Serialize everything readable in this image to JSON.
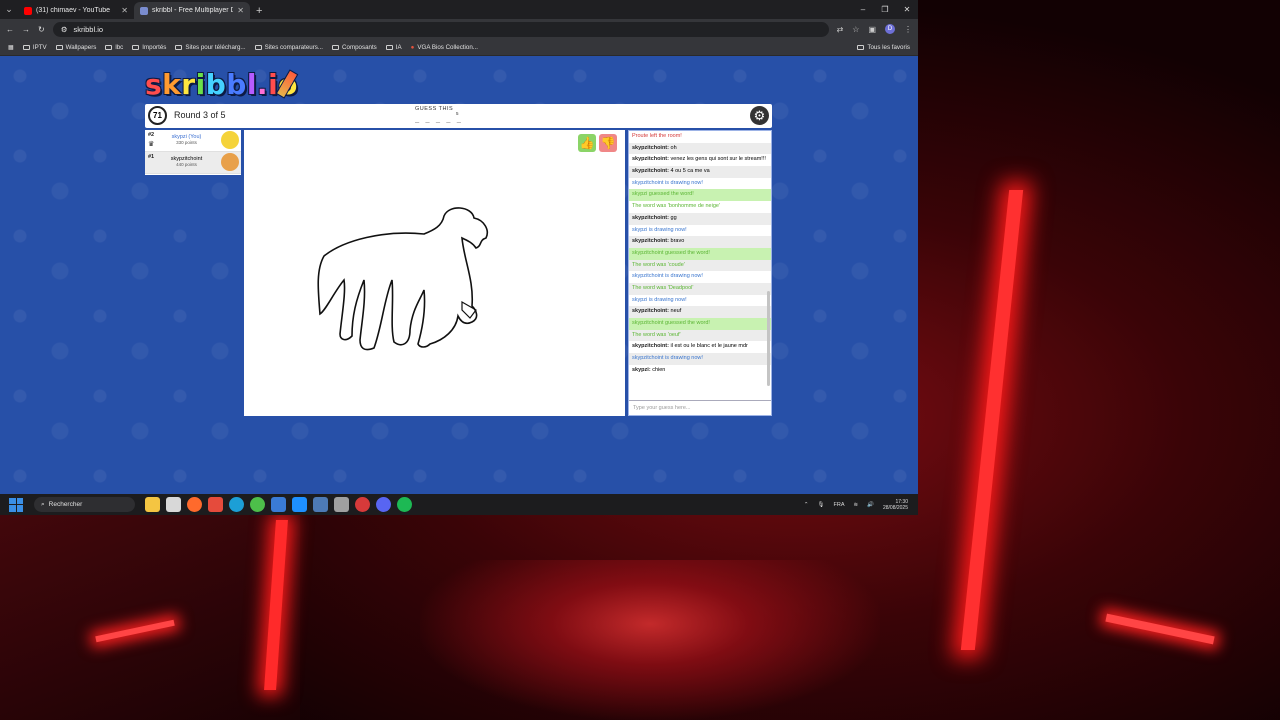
{
  "browser": {
    "tabs": [
      {
        "title": "(31) chimaev - YouTube",
        "favicon_color": "#ff0000",
        "active": false
      },
      {
        "title": "skribbl - Free Multiplayer Draw…",
        "favicon_color": "#7a8ccf",
        "active": true
      }
    ],
    "new_tab_symbol": "+",
    "window_controls": [
      "–",
      "❐",
      "✕"
    ],
    "address": "skribbl.io",
    "bookmarks": [
      "IPTV",
      "Wallpapers",
      "lbc",
      "Importés",
      "Sites pour télécharg...",
      "Sites comparateurs...",
      "Composants",
      "IA",
      "VGA Bios Collection..."
    ],
    "bookmarks_right": "Tous les favoris",
    "profile_letter": "D"
  },
  "game": {
    "logo_letters": [
      "s",
      "k",
      "r",
      "i",
      "b",
      "b",
      "l",
      ".",
      "i",
      "o"
    ],
    "timer": "71",
    "round": "Round 3 of 5",
    "guess_label": "GUESS THIS",
    "word_hint": "_ _ _ _ _",
    "word_length": "5",
    "players": [
      {
        "rank": "#2",
        "name": "skypzi (You)",
        "points": "330 points",
        "name_color": "#3a6fd1",
        "avatar_color": "#f5d33a",
        "crown": "♛"
      },
      {
        "rank": "#1",
        "name": "skypzitchoint",
        "points": "440 points",
        "name_color": "#222222",
        "avatar_color": "#e8a04a",
        "crown": ""
      }
    ],
    "thumb_up": "👍",
    "thumb_down": "👎",
    "chat": [
      {
        "type": "sys-red",
        "text": "Proute left the room!"
      },
      {
        "type": "msg",
        "user": "skypzitchoint:",
        "text": "oh"
      },
      {
        "type": "msg",
        "user": "skypzitchoint:",
        "text": "venez les gens qui sont sur le stream!!!"
      },
      {
        "type": "msg",
        "user": "skypzitchoint:",
        "text": "4 ou 5 ca me va"
      },
      {
        "type": "sys-blue",
        "text": "skypzitchoint is drawing now!"
      },
      {
        "type": "sys-green",
        "text": "skypzi guessed the word!"
      },
      {
        "type": "word-green",
        "text": "The word was 'bonhomme de neige'"
      },
      {
        "type": "msg",
        "user": "skypzitchoint:",
        "text": "gg"
      },
      {
        "type": "sys-blue",
        "text": "skypzi is drawing now!"
      },
      {
        "type": "msg",
        "user": "skypzitchoint:",
        "text": "bravo"
      },
      {
        "type": "sys-green",
        "text": "skypzitchoint guessed the word!"
      },
      {
        "type": "word-green",
        "text": "The word was 'coude'"
      },
      {
        "type": "sys-blue",
        "text": "skypzitchoint is drawing now!"
      },
      {
        "type": "word-green",
        "text": "The word was 'Deadpool'"
      },
      {
        "type": "sys-blue",
        "text": "skypzi is drawing now!"
      },
      {
        "type": "msg",
        "user": "skypzitchoint:",
        "text": "neuf"
      },
      {
        "type": "sys-green",
        "text": "skypzitchoint guessed the word!"
      },
      {
        "type": "word-green",
        "text": "The word was 'oeuf'"
      },
      {
        "type": "msg",
        "user": "skypzitchoint:",
        "text": "il est ou le blanc et le jaune mdr"
      },
      {
        "type": "sys-blue",
        "text": "skypzitchoint is drawing now!"
      },
      {
        "type": "msg",
        "user": "skypzi:",
        "text": "chien"
      }
    ],
    "chat_placeholder": "Type your guess here..."
  },
  "taskbar": {
    "search_label": "Rechercher",
    "app_colors": [
      "#f4c542",
      "#d8d8d8",
      "#ff6a2c",
      "#e54b3c",
      "#1c9fd6",
      "#4dbf4a",
      "#3a7bd5",
      "#1e90ff",
      "#4d7ab5",
      "#a0a0a0",
      "#d73a3a",
      "#5865f2",
      "#1db954"
    ],
    "language": "FRA",
    "time": "17:30",
    "date": "28/08/2025"
  }
}
